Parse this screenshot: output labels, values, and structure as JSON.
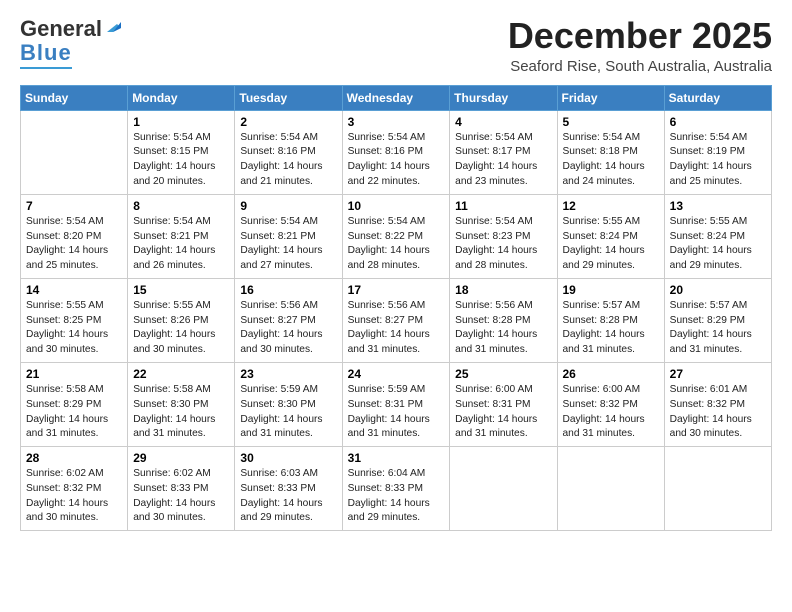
{
  "logo": {
    "general": "General",
    "blue": "Blue"
  },
  "header": {
    "month": "December 2025",
    "location": "Seaford Rise, South Australia, Australia"
  },
  "weekdays": [
    "Sunday",
    "Monday",
    "Tuesday",
    "Wednesday",
    "Thursday",
    "Friday",
    "Saturday"
  ],
  "weeks": [
    [
      {
        "day": "",
        "info": ""
      },
      {
        "day": "1",
        "info": "Sunrise: 5:54 AM\nSunset: 8:15 PM\nDaylight: 14 hours\nand 20 minutes."
      },
      {
        "day": "2",
        "info": "Sunrise: 5:54 AM\nSunset: 8:16 PM\nDaylight: 14 hours\nand 21 minutes."
      },
      {
        "day": "3",
        "info": "Sunrise: 5:54 AM\nSunset: 8:16 PM\nDaylight: 14 hours\nand 22 minutes."
      },
      {
        "day": "4",
        "info": "Sunrise: 5:54 AM\nSunset: 8:17 PM\nDaylight: 14 hours\nand 23 minutes."
      },
      {
        "day": "5",
        "info": "Sunrise: 5:54 AM\nSunset: 8:18 PM\nDaylight: 14 hours\nand 24 minutes."
      },
      {
        "day": "6",
        "info": "Sunrise: 5:54 AM\nSunset: 8:19 PM\nDaylight: 14 hours\nand 25 minutes."
      }
    ],
    [
      {
        "day": "7",
        "info": "Sunrise: 5:54 AM\nSunset: 8:20 PM\nDaylight: 14 hours\nand 25 minutes."
      },
      {
        "day": "8",
        "info": "Sunrise: 5:54 AM\nSunset: 8:21 PM\nDaylight: 14 hours\nand 26 minutes."
      },
      {
        "day": "9",
        "info": "Sunrise: 5:54 AM\nSunset: 8:21 PM\nDaylight: 14 hours\nand 27 minutes."
      },
      {
        "day": "10",
        "info": "Sunrise: 5:54 AM\nSunset: 8:22 PM\nDaylight: 14 hours\nand 28 minutes."
      },
      {
        "day": "11",
        "info": "Sunrise: 5:54 AM\nSunset: 8:23 PM\nDaylight: 14 hours\nand 28 minutes."
      },
      {
        "day": "12",
        "info": "Sunrise: 5:55 AM\nSunset: 8:24 PM\nDaylight: 14 hours\nand 29 minutes."
      },
      {
        "day": "13",
        "info": "Sunrise: 5:55 AM\nSunset: 8:24 PM\nDaylight: 14 hours\nand 29 minutes."
      }
    ],
    [
      {
        "day": "14",
        "info": "Sunrise: 5:55 AM\nSunset: 8:25 PM\nDaylight: 14 hours\nand 30 minutes."
      },
      {
        "day": "15",
        "info": "Sunrise: 5:55 AM\nSunset: 8:26 PM\nDaylight: 14 hours\nand 30 minutes."
      },
      {
        "day": "16",
        "info": "Sunrise: 5:56 AM\nSunset: 8:27 PM\nDaylight: 14 hours\nand 30 minutes."
      },
      {
        "day": "17",
        "info": "Sunrise: 5:56 AM\nSunset: 8:27 PM\nDaylight: 14 hours\nand 31 minutes."
      },
      {
        "day": "18",
        "info": "Sunrise: 5:56 AM\nSunset: 8:28 PM\nDaylight: 14 hours\nand 31 minutes."
      },
      {
        "day": "19",
        "info": "Sunrise: 5:57 AM\nSunset: 8:28 PM\nDaylight: 14 hours\nand 31 minutes."
      },
      {
        "day": "20",
        "info": "Sunrise: 5:57 AM\nSunset: 8:29 PM\nDaylight: 14 hours\nand 31 minutes."
      }
    ],
    [
      {
        "day": "21",
        "info": "Sunrise: 5:58 AM\nSunset: 8:29 PM\nDaylight: 14 hours\nand 31 minutes."
      },
      {
        "day": "22",
        "info": "Sunrise: 5:58 AM\nSunset: 8:30 PM\nDaylight: 14 hours\nand 31 minutes."
      },
      {
        "day": "23",
        "info": "Sunrise: 5:59 AM\nSunset: 8:30 PM\nDaylight: 14 hours\nand 31 minutes."
      },
      {
        "day": "24",
        "info": "Sunrise: 5:59 AM\nSunset: 8:31 PM\nDaylight: 14 hours\nand 31 minutes."
      },
      {
        "day": "25",
        "info": "Sunrise: 6:00 AM\nSunset: 8:31 PM\nDaylight: 14 hours\nand 31 minutes."
      },
      {
        "day": "26",
        "info": "Sunrise: 6:00 AM\nSunset: 8:32 PM\nDaylight: 14 hours\nand 31 minutes."
      },
      {
        "day": "27",
        "info": "Sunrise: 6:01 AM\nSunset: 8:32 PM\nDaylight: 14 hours\nand 30 minutes."
      }
    ],
    [
      {
        "day": "28",
        "info": "Sunrise: 6:02 AM\nSunset: 8:32 PM\nDaylight: 14 hours\nand 30 minutes."
      },
      {
        "day": "29",
        "info": "Sunrise: 6:02 AM\nSunset: 8:33 PM\nDaylight: 14 hours\nand 30 minutes."
      },
      {
        "day": "30",
        "info": "Sunrise: 6:03 AM\nSunset: 8:33 PM\nDaylight: 14 hours\nand 29 minutes."
      },
      {
        "day": "31",
        "info": "Sunrise: 6:04 AM\nSunset: 8:33 PM\nDaylight: 14 hours\nand 29 minutes."
      },
      {
        "day": "",
        "info": ""
      },
      {
        "day": "",
        "info": ""
      },
      {
        "day": "",
        "info": ""
      }
    ]
  ]
}
